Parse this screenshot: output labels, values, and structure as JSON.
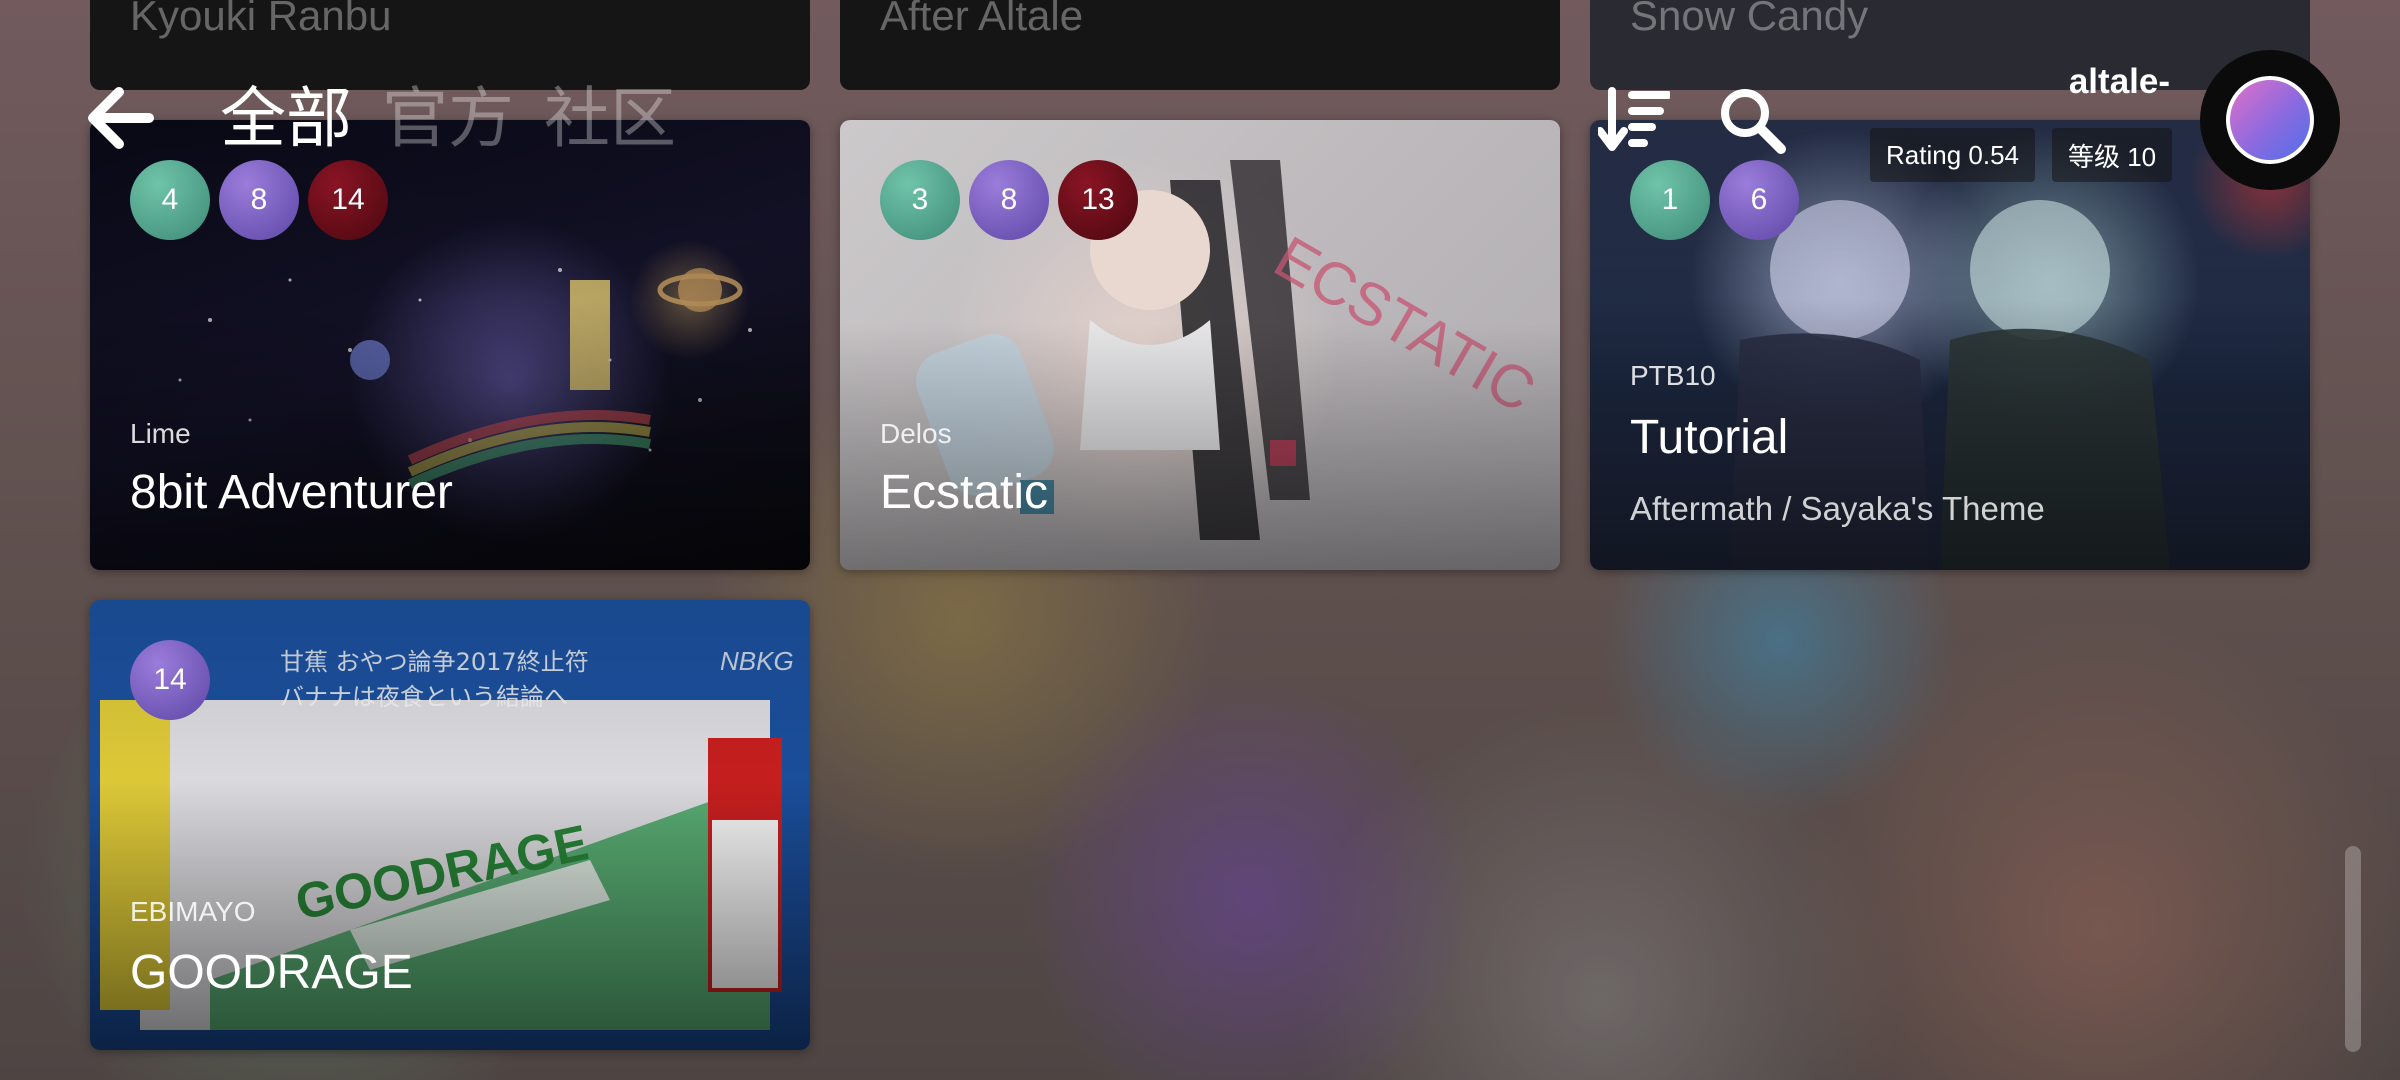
{
  "header": {
    "tabs": [
      {
        "label": "全部",
        "active": true
      },
      {
        "label": "官方",
        "active": false
      },
      {
        "label": "社区",
        "active": false
      }
    ],
    "icons": {
      "back": "back-arrow-icon",
      "sort": "sort-descending-icon",
      "search": "search-icon"
    }
  },
  "profile": {
    "username": "altale-",
    "rating": "Rating 0.54",
    "level": "等级 10"
  },
  "top_row": [
    "Kyouki Ranbu",
    "After Altale",
    "Snow Candy"
  ],
  "songs": [
    {
      "artist": "Lime",
      "title": "8bit Adventurer",
      "subtitle": "",
      "difficulties": [
        "4",
        "8",
        "14"
      ]
    },
    {
      "artist": "Delos",
      "title": "Ecstatic",
      "subtitle": "",
      "difficulties": [
        "3",
        "8",
        "13"
      ]
    },
    {
      "artist": "PTB10",
      "title": "Tutorial",
      "subtitle": "Aftermath / Sayaka's Theme",
      "difficulties": [
        "1",
        "6"
      ]
    },
    {
      "artist": "EBIMAYO",
      "title": "GOODRAGE",
      "subtitle": "",
      "difficulties": [
        "14"
      ]
    }
  ],
  "colors": {
    "easy": "#4fa88e",
    "hard": "#7a5ec6",
    "extreme": "#6a0e1a"
  }
}
